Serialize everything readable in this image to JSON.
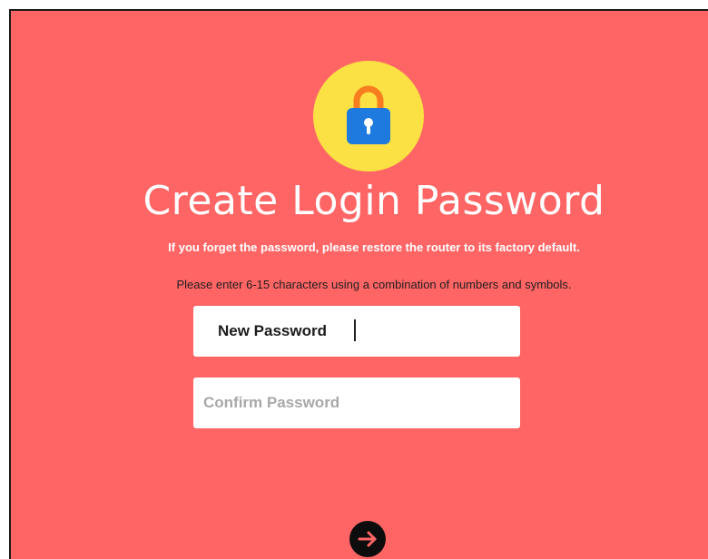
{
  "header": {
    "icon": "lock-icon",
    "title": "Create Login Password",
    "warning": "If you forget the password, please restore the router to its factory default.",
    "hint": "Please enter 6-15 characters using a combination of numbers and symbols."
  },
  "form": {
    "new_password": {
      "label": "New Password",
      "value": ""
    },
    "confirm_password": {
      "placeholder": "Confirm Password",
      "value": ""
    },
    "submit_icon": "arrow-right-icon"
  },
  "colors": {
    "background": "#ff6565",
    "badge": "#fbe143",
    "lock_body": "#1f7ae0",
    "lock_shackle": "#f77d1e",
    "button": "#0d0d0d",
    "arrow": "#ff6565"
  }
}
